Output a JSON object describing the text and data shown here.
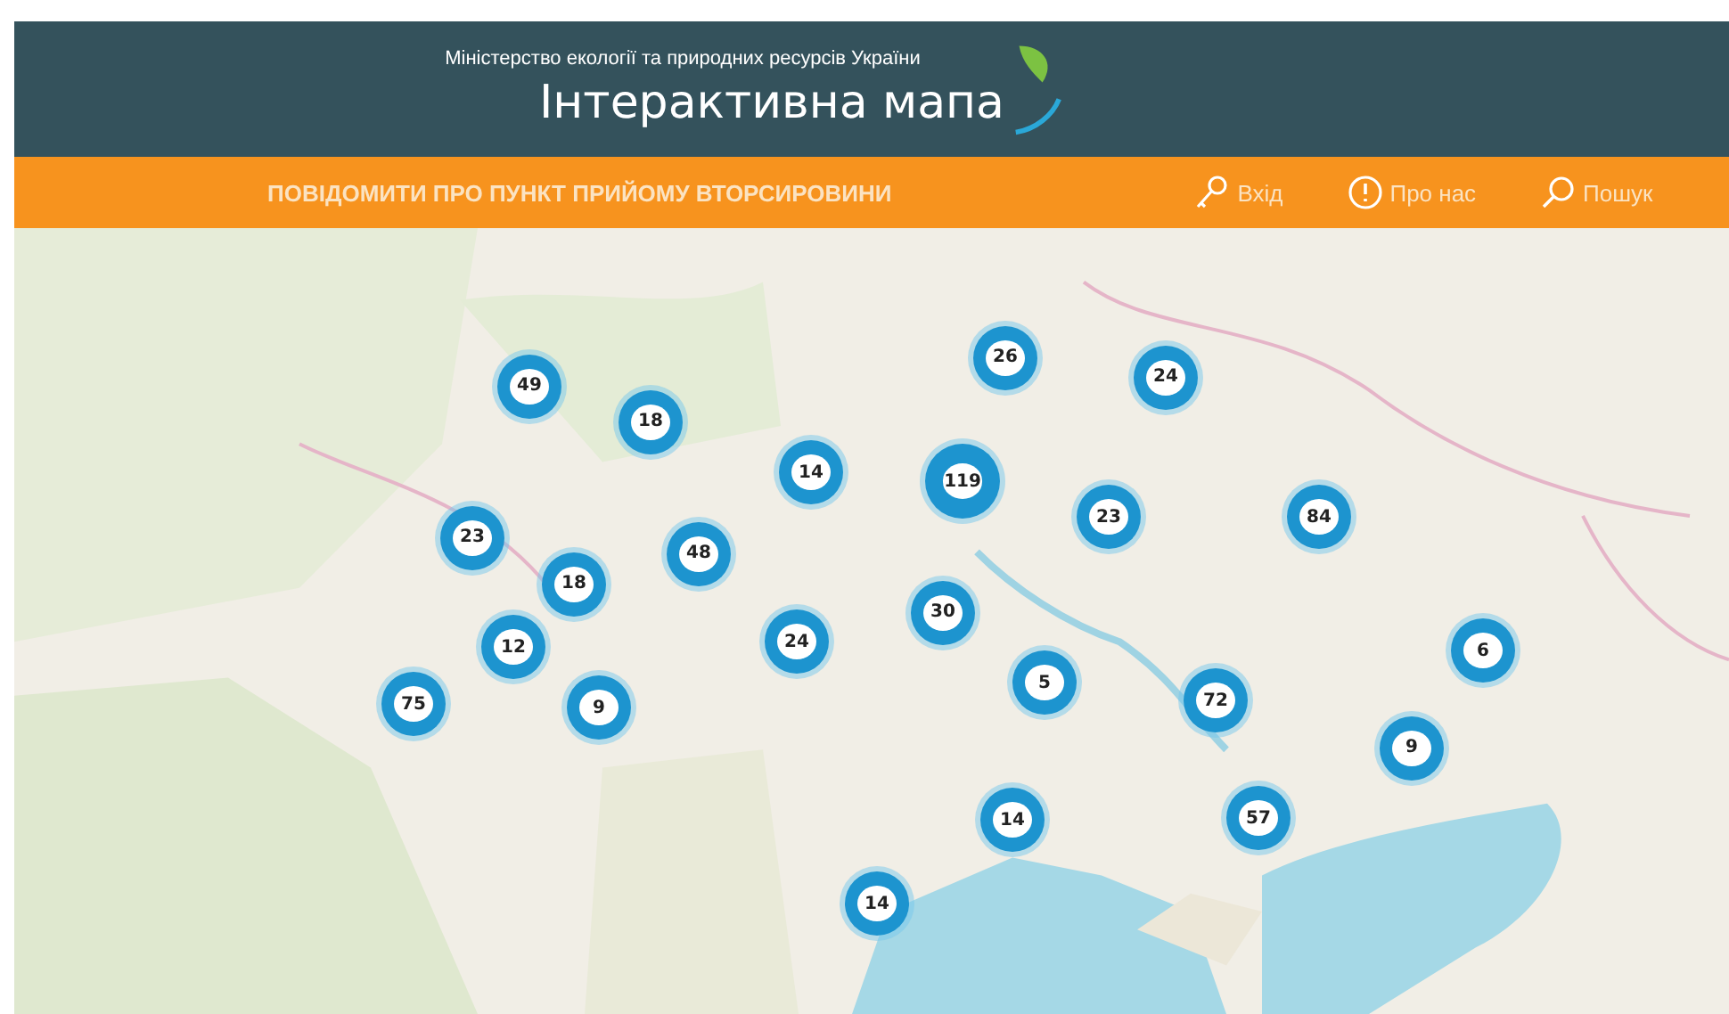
{
  "header": {
    "ministry": "Міністерство екології та природних ресурсів України",
    "title": "Інтерактивна мапа"
  },
  "nav": {
    "report_link": "ПОВІДОМИТИ ПРО ПУНКТ ПРИЙОМУ ВТОРСИРОВИНИ",
    "items": [
      {
        "kind": "login",
        "label": "Вхід"
      },
      {
        "kind": "about",
        "label": "Про нас"
      },
      {
        "kind": "search",
        "label": "Пошук"
      }
    ]
  },
  "map": {
    "kind": "picture",
    "clusters": [
      {
        "count": "49"
      },
      {
        "count": "18"
      },
      {
        "count": "14"
      },
      {
        "count": "119"
      },
      {
        "count": "26"
      },
      {
        "count": "24"
      },
      {
        "count": "23"
      },
      {
        "count": "48"
      },
      {
        "count": "18"
      },
      {
        "count": "12"
      },
      {
        "count": "75"
      },
      {
        "count": "9"
      },
      {
        "count": "24"
      },
      {
        "count": "30"
      },
      {
        "count": "5"
      },
      {
        "count": "23"
      },
      {
        "count": "84"
      },
      {
        "count": "72"
      },
      {
        "count": "6"
      },
      {
        "count": "9"
      },
      {
        "count": "14"
      },
      {
        "count": "57"
      },
      {
        "count": "14"
      }
    ]
  }
}
